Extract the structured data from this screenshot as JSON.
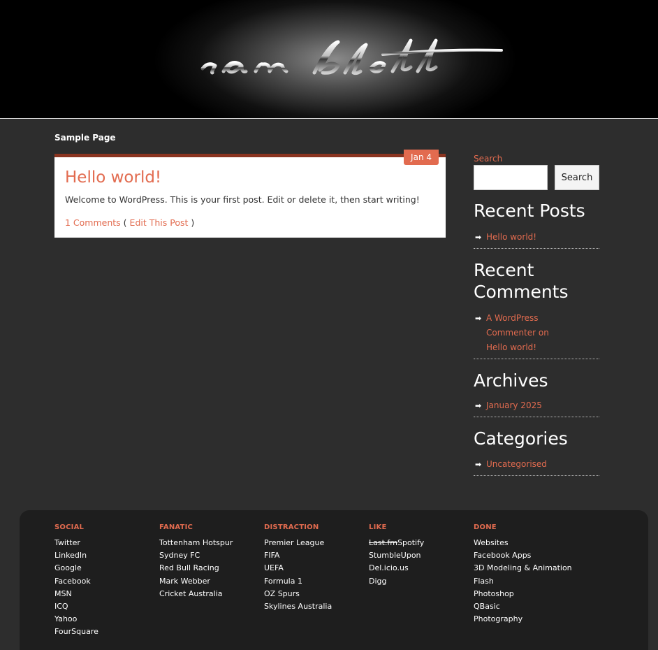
{
  "header": {
    "logo_text": "ian blott"
  },
  "nav": {
    "items": [
      {
        "label": "Sample Page"
      }
    ]
  },
  "post": {
    "date": "Jan 4",
    "title": "Hello world!",
    "excerpt": "Welcome to WordPress. This is your first post. Edit or delete it, then start writing!",
    "comments_link": "1 Comments",
    "edit_link": "Edit This Post",
    "paren_open": "(",
    "paren_close": ")"
  },
  "sidebar": {
    "search_label": "Search",
    "search_value": "",
    "search_button": "Search",
    "widgets": [
      {
        "title": "Recent Posts",
        "items": [
          "Hello world!"
        ]
      },
      {
        "title": "Recent Comments",
        "items": [
          "A WordPress Commenter on Hello world!"
        ]
      },
      {
        "title": "Archives",
        "items": [
          "January 2025"
        ]
      },
      {
        "title": "Categories",
        "items": [
          "Uncategorised"
        ]
      }
    ]
  },
  "footer": {
    "columns": [
      {
        "heading": "SOCIAL",
        "items": [
          "Twitter",
          "LinkedIn",
          "Google",
          "Facebook",
          "MSN",
          "ICQ",
          "Yahoo",
          "FourSquare"
        ]
      },
      {
        "heading": "FANATIC",
        "items": [
          "Tottenham Hotspur",
          "Sydney FC",
          "Red Bull Racing",
          "Mark Webber",
          "Cricket Australia"
        ]
      },
      {
        "heading": "DISTRACTION",
        "items": [
          "Premier League",
          "FIFA",
          "UEFA",
          "Formula 1",
          "OZ Spurs",
          "Skylines Australia"
        ]
      },
      {
        "heading": "LIKE",
        "items": [
          "StumbleUpon",
          "Del.icio.us",
          "Digg"
        ],
        "first_struck": "Last.fm",
        "first_rest": "Spotify"
      },
      {
        "heading": "DONE",
        "items": [
          "Websites",
          "Facebook Apps",
          "3D Modeling & Animation",
          "Flash",
          "Photoshop",
          "QBasic",
          "Photography"
        ]
      }
    ]
  },
  "colors": {
    "accent": "#e26b4f",
    "background": "#2d2d2d",
    "footer_bg": "#1e1e1e",
    "post_border": "#8a3420"
  },
  "icons": {
    "list_bullet": "arrow-right-icon"
  }
}
